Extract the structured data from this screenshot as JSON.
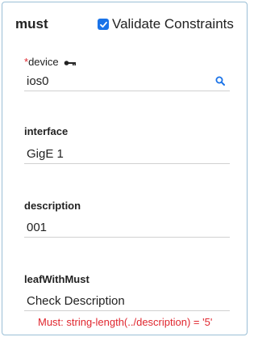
{
  "header": {
    "title": "must",
    "validate_label": "Validate Constraints",
    "validate_checked": true
  },
  "fields": {
    "device": {
      "required_mark": "*",
      "label": "device",
      "value": "ios0",
      "icon": "key-icon",
      "action_icon": "search-icon"
    },
    "interface": {
      "label": "interface",
      "value": "GigE 1"
    },
    "description": {
      "label": "description",
      "value": "001"
    },
    "leafWithMust": {
      "label": "leafWithMust",
      "value": "Check Description",
      "error": "Must: string-length(../description) = '5'"
    }
  },
  "colors": {
    "accent": "#1a73e8",
    "error": "#e0262e",
    "border": "#9bbfd6"
  }
}
